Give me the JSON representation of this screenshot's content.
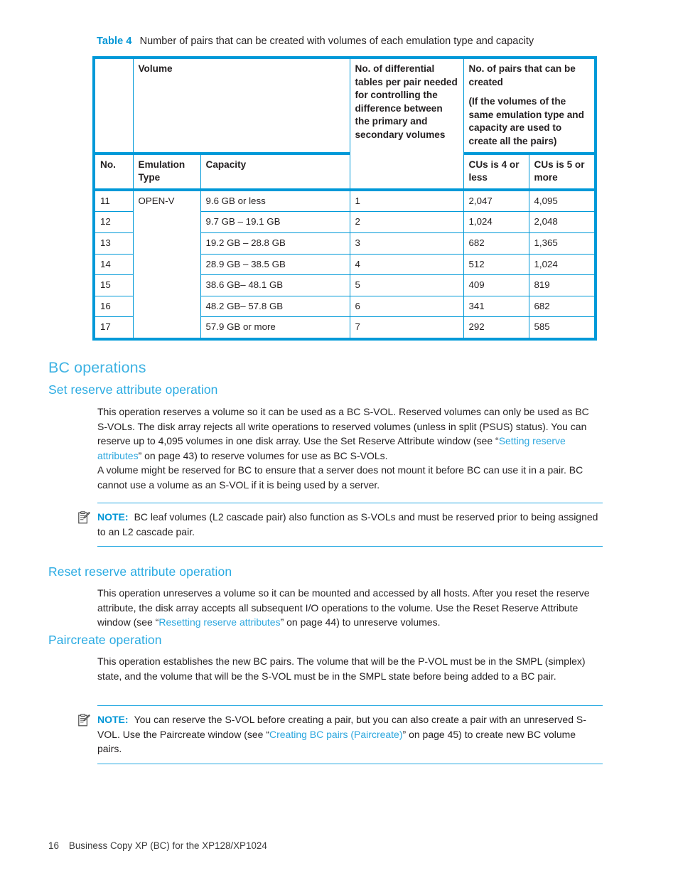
{
  "table": {
    "caption_label": "Table 4",
    "caption_text": "Number of pairs that can be created with volumes of each emulation type and capacity",
    "header": {
      "volume": "Volume",
      "differential": "No. of differential tables per pair needed for controlling the difference between the primary and secondary volumes",
      "pairs_main": "No. of pairs that can be created",
      "pairs_sub": "(If the volumes of the same emulation type and capacity are used to create all the pairs)",
      "no": "No.",
      "emulation_type": "Emulation Type",
      "capacity": "Capacity",
      "cus_4": "CUs is 4 or less",
      "cus_5": "CUs is 5 or more"
    },
    "rows": [
      {
        "no": "11",
        "emulation": "OPEN-V",
        "capacity": "9.6 GB or less",
        "diff": "1",
        "cus4": "2,047",
        "cus5": "4,095"
      },
      {
        "no": "12",
        "emulation": "",
        "capacity": "9.7 GB – 19.1 GB",
        "diff": "2",
        "cus4": "1,024",
        "cus5": "2,048"
      },
      {
        "no": "13",
        "emulation": "",
        "capacity": "19.2 GB – 28.8 GB",
        "diff": "3",
        "cus4": "682",
        "cus5": "1,365"
      },
      {
        "no": "14",
        "emulation": "",
        "capacity": "28.9 GB – 38.5 GB",
        "diff": "4",
        "cus4": "512",
        "cus5": "1,024"
      },
      {
        "no": "15",
        "emulation": "",
        "capacity": "38.6 GB– 48.1 GB",
        "diff": "5",
        "cus4": "409",
        "cus5": "819"
      },
      {
        "no": "16",
        "emulation": "",
        "capacity": "48.2 GB– 57.8 GB",
        "diff": "6",
        "cus4": "341",
        "cus5": "682"
      },
      {
        "no": "17",
        "emulation": "",
        "capacity": "57.9 GB or more",
        "diff": "7",
        "cus4": "292",
        "cus5": "585"
      }
    ]
  },
  "sections": {
    "bc_operations_title": "BC operations",
    "set_reserve": {
      "title": "Set reserve attribute operation",
      "para1_a": "This operation reserves a volume so it can be used as a BC S-VOL. Reserved volumes can only be used as BC S-VOLs. The disk array rejects all write operations to reserved volumes (unless in split (PSUS) status). You can reserve up to 4,095 volumes in one disk array. Use the Set Reserve Attribute window (see “",
      "para1_link": "Setting reserve attributes",
      "para1_b": "” on page 43) to reserve volumes for use as BC S-VOLs.",
      "para2": "A volume might be reserved for BC to ensure that a server does not mount it before BC can use it in a pair. BC cannot use a volume as an S-VOL if it is being used by a server."
    },
    "note1": {
      "label": "NOTE:",
      "text": "BC leaf volumes (L2 cascade pair) also function as S-VOLs and must be reserved prior to being assigned to an L2 cascade pair."
    },
    "reset_reserve": {
      "title": "Reset reserve attribute operation",
      "para_a": "This operation unreserves a volume so it can be mounted and accessed by all hosts. After you reset the reserve attribute, the disk array accepts all subsequent I/O operations to the volume. Use the Reset Reserve Attribute window (see “",
      "para_link": "Resetting reserve attributes",
      "para_b": "” on page 44) to unreserve volumes."
    },
    "paircreate": {
      "title": "Paircreate operation",
      "para": "This operation establishes the new BC pairs. The volume that will be the P-VOL must be in the SMPL (simplex) state, and the volume that will be the S-VOL must be in the SMPL state before being added to a BC pair."
    },
    "note2": {
      "label": "NOTE:",
      "text_a": "You can reserve the S-VOL before creating a pair, but you can also create a pair with an unreserved S-VOL. Use the Paircreate window (see “",
      "link": "Creating BC pairs (Paircreate)",
      "text_b": "” on page 45) to create new BC volume pairs."
    }
  },
  "footer": {
    "page_number": "16",
    "doc_title": "Business Copy XP (BC) for the XP128/XP1024"
  },
  "colors": {
    "accent_cyan": "#0096d6",
    "heading_blue": "#3fb3e3",
    "link_blue": "#2ba6de",
    "table_border": "#0099d8",
    "body_text": "#231f20"
  },
  "icons": {
    "note": "note-clipboard-pencil-icon"
  }
}
